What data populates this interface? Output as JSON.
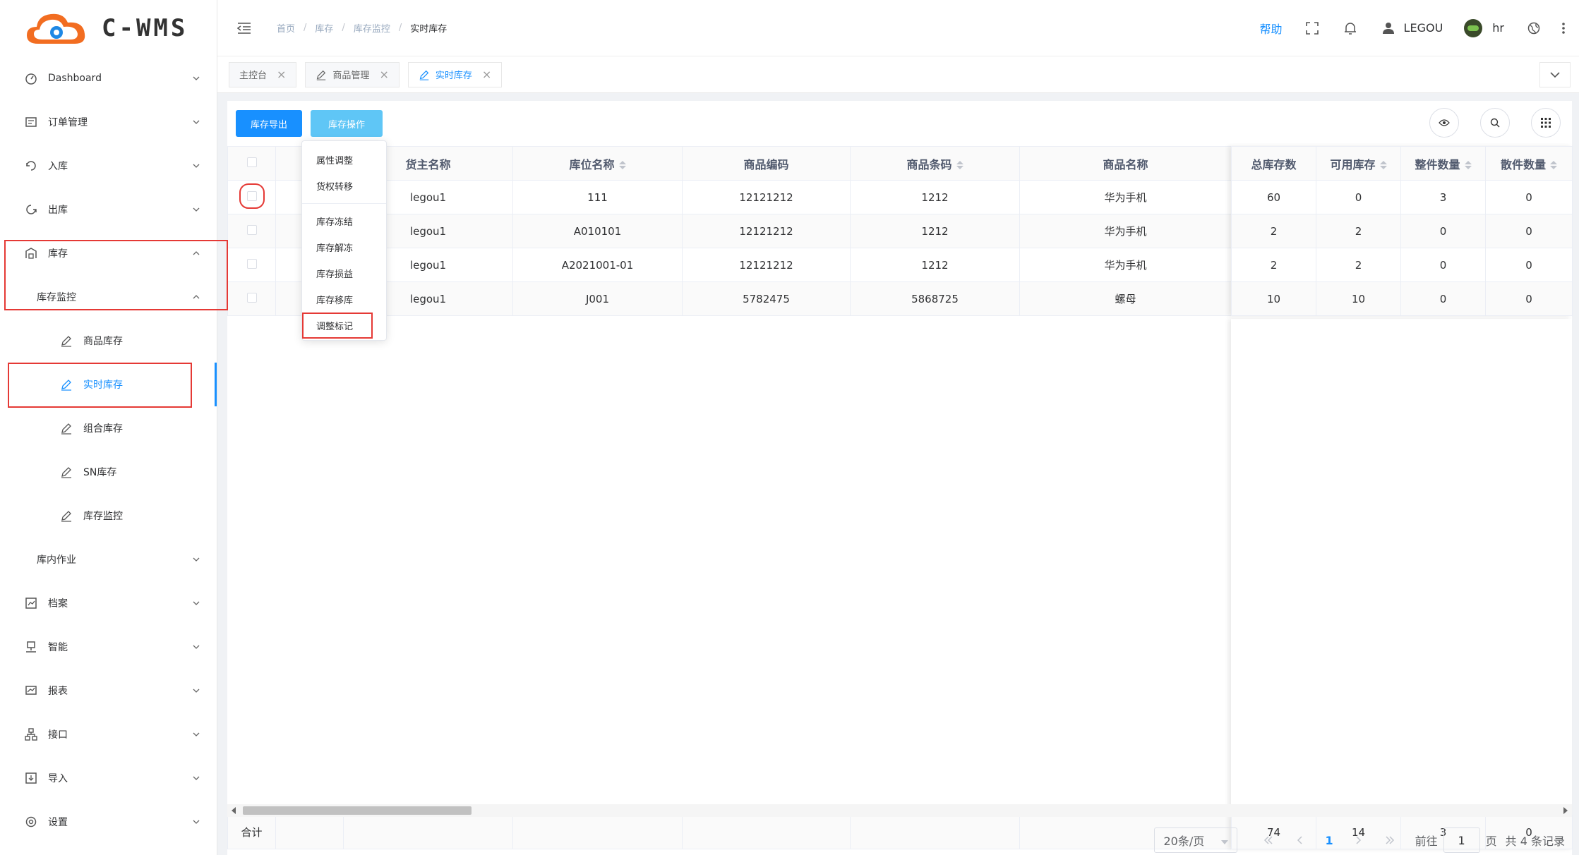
{
  "app": {
    "logo_text": "C-WMS",
    "colors": {
      "accent": "#1890ff",
      "accent_light": "#5fc6f6",
      "highlight": "#e53935",
      "logo_orange": "#f26d21"
    }
  },
  "sidebar": {
    "items": [
      {
        "label": "Dashboard",
        "icon": "dashboard-icon",
        "arrow": "down"
      },
      {
        "label": "订单管理",
        "icon": "order-icon",
        "arrow": "down"
      },
      {
        "label": "入库",
        "icon": "inbound-icon",
        "arrow": "down"
      },
      {
        "label": "出库",
        "icon": "outbound-icon",
        "arrow": "down"
      },
      {
        "label": "库存",
        "icon": "warehouse-icon",
        "arrow": "up"
      },
      {
        "label": "库存监控",
        "arrow": "up"
      },
      {
        "label": "商品库存",
        "icon": "edit-icon"
      },
      {
        "label": "实时库存",
        "icon": "edit-icon",
        "active": true
      },
      {
        "label": "组合库存",
        "icon": "edit-icon"
      },
      {
        "label": "SN库存",
        "icon": "edit-icon"
      },
      {
        "label": "库存监控",
        "icon": "edit-icon"
      },
      {
        "label": "库内作业",
        "arrow": "down"
      },
      {
        "label": "档案",
        "icon": "archive-icon",
        "arrow": "down"
      },
      {
        "label": "智能",
        "icon": "smart-icon",
        "arrow": "down"
      },
      {
        "label": "报表",
        "icon": "report-icon",
        "arrow": "down"
      },
      {
        "label": "接口",
        "icon": "api-icon",
        "arrow": "down"
      },
      {
        "label": "导入",
        "icon": "import-icon",
        "arrow": "down"
      },
      {
        "label": "设置",
        "icon": "settings-icon",
        "arrow": "down"
      }
    ]
  },
  "header": {
    "breadcrumb": [
      "首页",
      "库存",
      "库存监控",
      "实时库存"
    ],
    "help_label": "帮助",
    "user_label": "LEGOU",
    "role_label": "hr"
  },
  "tabs": [
    {
      "label": "主控台",
      "icon": ""
    },
    {
      "label": "商品管理",
      "icon": "edit-icon"
    },
    {
      "label": "实时库存",
      "icon": "edit-icon",
      "active": true
    }
  ],
  "toolbar": {
    "export_label": "库存导出",
    "operate_label": "库存操作"
  },
  "dropdown": {
    "items": [
      "属性调整",
      "货权转移",
      "库存冻结",
      "库存解冻",
      "库存损益",
      "库存移库",
      "调整标记"
    ]
  },
  "table": {
    "columns": [
      "货主名称",
      "库位名称",
      "商品编码",
      "商品条码",
      "商品名称"
    ],
    "fixed_columns": [
      "总库存数",
      "可用库存",
      "整件数量",
      "散件数量"
    ],
    "rows": [
      {
        "owner": "legou1",
        "location": "111",
        "code": "12121212",
        "barcode": "1212",
        "name": "华为手机",
        "total": "60",
        "available": "0",
        "whole": "3",
        "loose": "0"
      },
      {
        "owner": "legou1",
        "location": "A010101",
        "code": "12121212",
        "barcode": "1212",
        "name": "华为手机",
        "total": "2",
        "available": "2",
        "whole": "0",
        "loose": "0"
      },
      {
        "owner": "legou1",
        "location": "A2021001-01",
        "code": "12121212",
        "barcode": "1212",
        "name": "华为手机",
        "total": "2",
        "available": "2",
        "whole": "0",
        "loose": "0"
      },
      {
        "owner": "legou1",
        "location": "J001",
        "code": "5782475",
        "barcode": "5868725",
        "name": "螺母",
        "total": "10",
        "available": "10",
        "whole": "0",
        "loose": "0"
      }
    ],
    "summary": {
      "label": "合计",
      "total": "74",
      "available": "14",
      "whole": "3",
      "loose": "0"
    }
  },
  "pagination": {
    "page_size": "20条/页",
    "current_page": "1",
    "goto_label": "前往",
    "goto_value": "1",
    "page_suffix": "页",
    "total_text": "共 4 条记录"
  }
}
